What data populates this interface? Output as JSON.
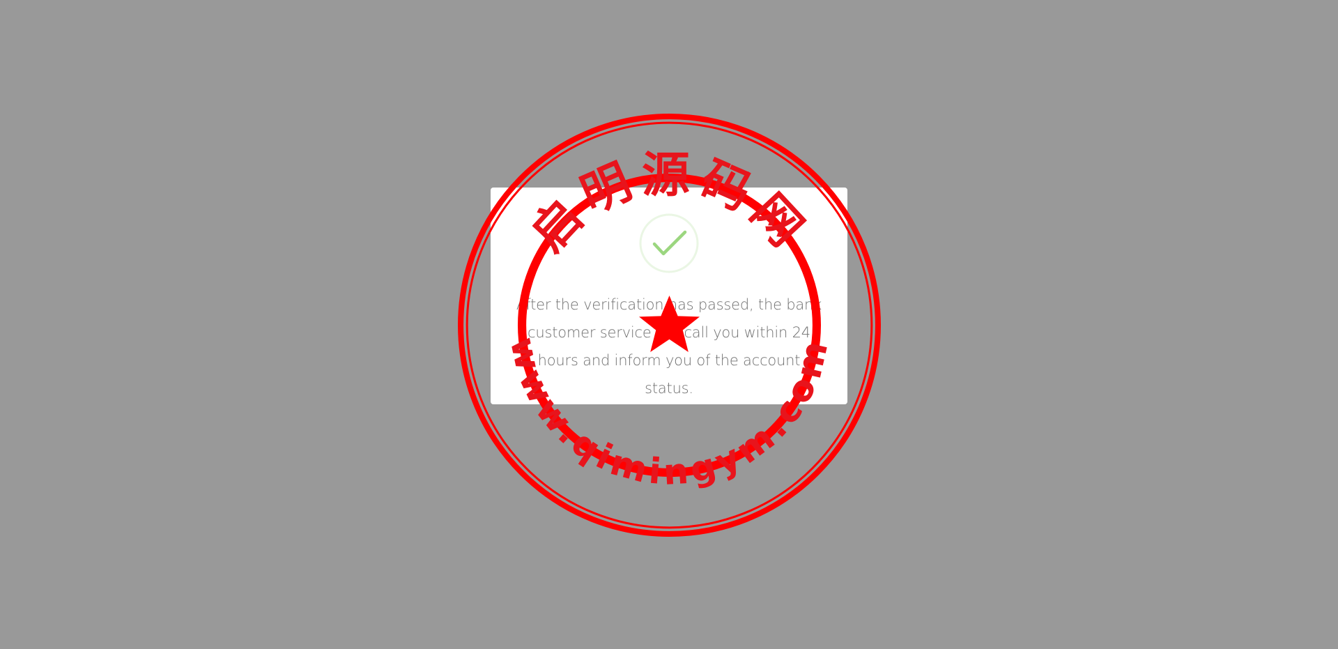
{
  "dialog": {
    "message": "After the verification has passed, the bank customer service will call you within 24 hours and inform you of the account status.",
    "success_icon": "checkmark-circle-icon"
  },
  "watermark": {
    "top_text": "启明源码网",
    "bottom_text": "www.qimingym.com"
  },
  "colors": {
    "overlay": "#999999",
    "success_green": "#9bd67f",
    "stamp_red": "#ff0000"
  }
}
